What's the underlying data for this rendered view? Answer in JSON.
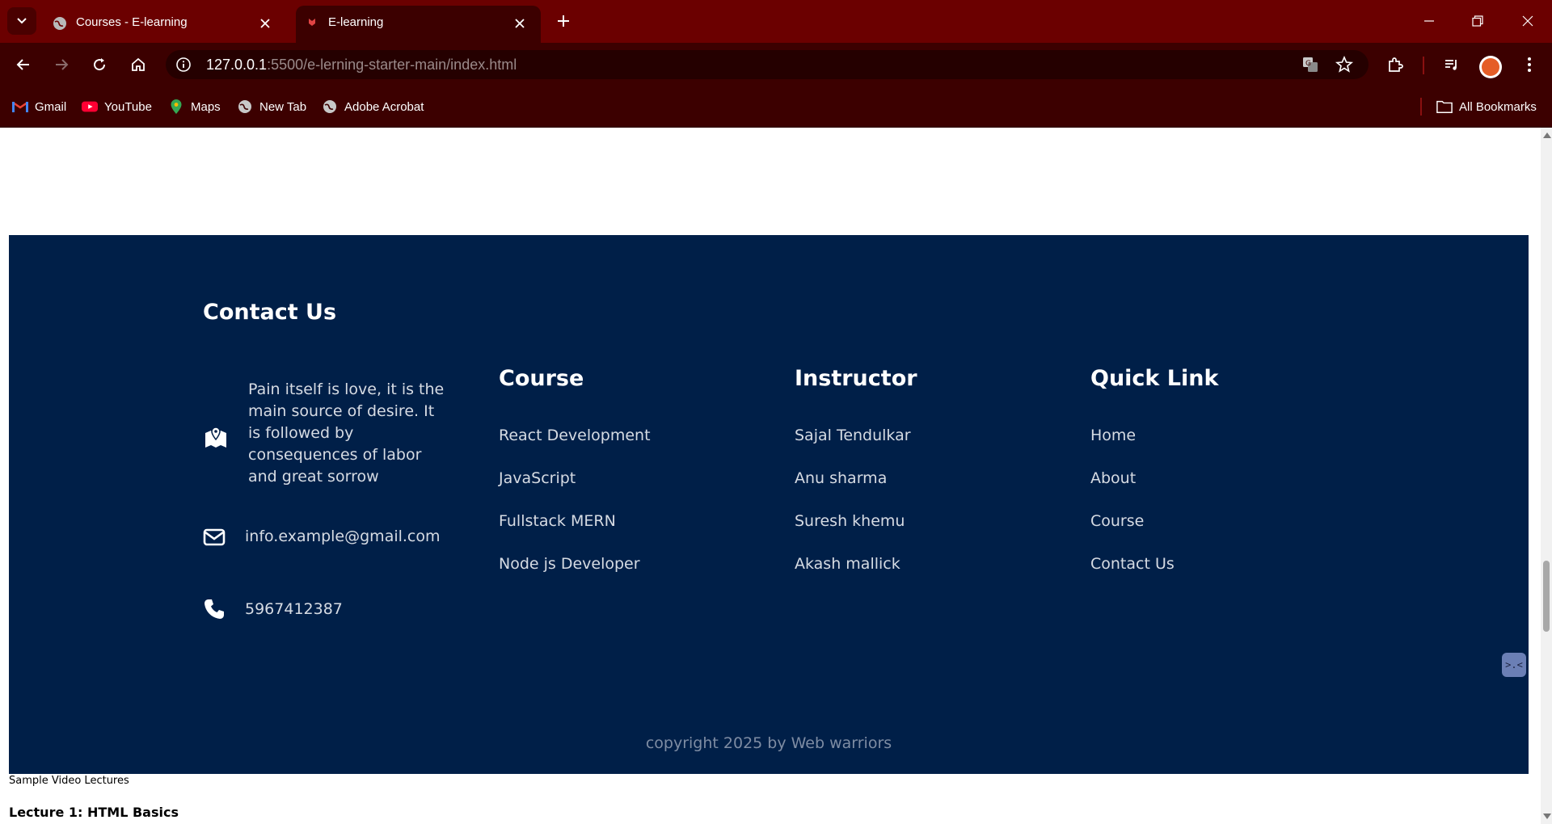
{
  "browser": {
    "tabs": [
      {
        "title": "Courses - E-learning",
        "active": false
      },
      {
        "title": "E-learning",
        "active": true
      }
    ],
    "url_host": "127.0.0.1",
    "url_rest": ":5500/e-lerning-starter-main/index.html",
    "bookmarks": [
      {
        "label": "Gmail",
        "icon": "gmail-icon"
      },
      {
        "label": "YouTube",
        "icon": "youtube-icon"
      },
      {
        "label": "Maps",
        "icon": "maps-icon"
      },
      {
        "label": "New Tab",
        "icon": "globe-icon"
      },
      {
        "label": "Adobe Acrobat",
        "icon": "globe-icon"
      }
    ],
    "all_bookmarks": "All Bookmarks",
    "colors": {
      "frame": "#6b0000",
      "toolbar": "#3c0000"
    }
  },
  "footer": {
    "contact_title": "Contact Us",
    "address": "Pain itself is love, it is the main source of desire. It is followed by consequences of labor and great sorrow",
    "email": "info.example@gmail.com",
    "phone": "5967412387",
    "course": {
      "title": "Course",
      "links": [
        "React Development",
        "JavaScript",
        "Fullstack MERN",
        "Node js Developer"
      ]
    },
    "instructor": {
      "title": "Instructor",
      "links": [
        "Sajal Tendulkar",
        "Anu sharma",
        "Suresh khemu",
        "Akash mallick"
      ]
    },
    "quick_link": {
      "title": "Quick Link",
      "links": [
        "Home",
        "About",
        "Course",
        "Contact Us"
      ]
    },
    "copyright": "copyright 2025 by Web warriors",
    "colors": {
      "background": "#001f48",
      "link": "#d6dbe3"
    }
  },
  "below": {
    "caption": "Sample Video Lectures",
    "heading": "Lecture 1: HTML Basics"
  }
}
